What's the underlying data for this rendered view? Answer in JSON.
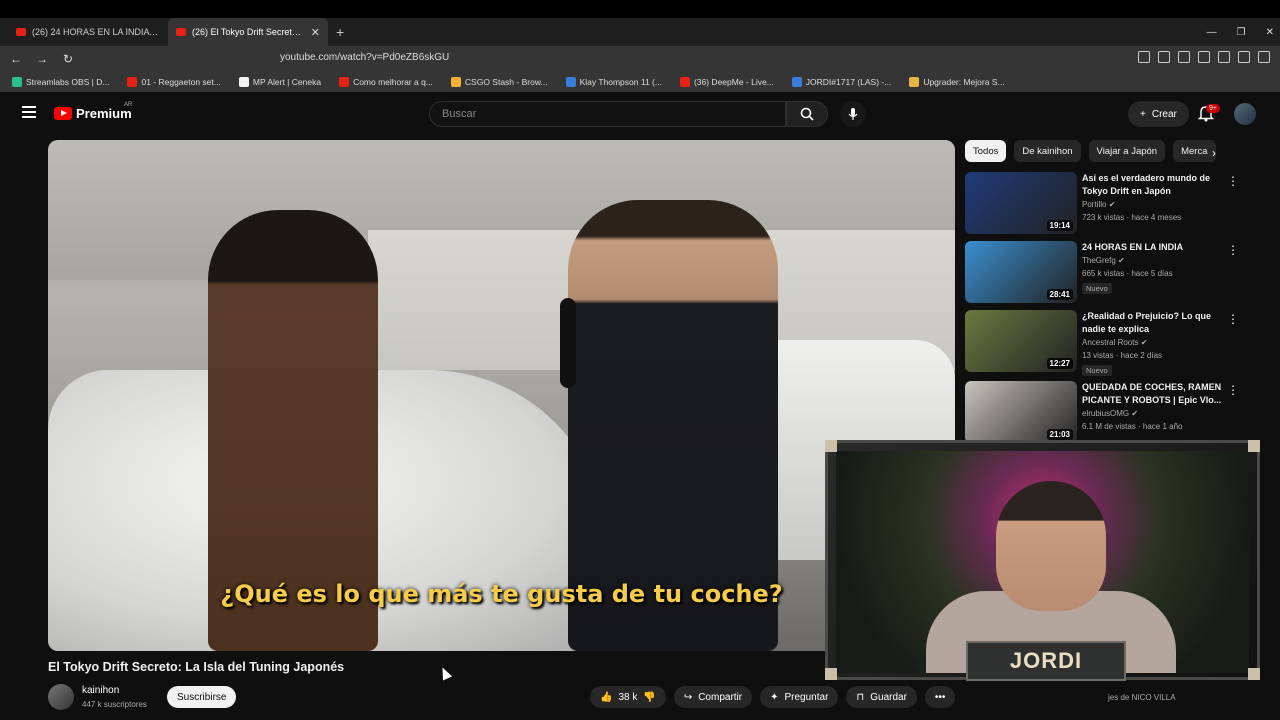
{
  "browser": {
    "tabs": [
      {
        "label": "(26) 24 HORAS EN LA INDIA - YouTube",
        "active": false
      },
      {
        "label": "(26) El Tokyo Drift Secreto: La",
        "active": true
      }
    ],
    "url": "youtube.com/watch?v=Pd0eZB6skGU",
    "bookmarks": [
      {
        "label": "Streamlabs OBS | D...",
        "color": "#2dbe8d"
      },
      {
        "label": "01 - Reggaeton set...",
        "color": "#e62117"
      },
      {
        "label": "MP Alert | Ceneka",
        "color": "#f2f2f2"
      },
      {
        "label": "Como melhorar a q...",
        "color": "#e62117"
      },
      {
        "label": "CSGO Stash - Brow...",
        "color": "#f2b233"
      },
      {
        "label": "Klay Thompson 11 (...",
        "color": "#3b7ddd"
      },
      {
        "label": "(36) DeepMe - Live...",
        "color": "#e62117"
      },
      {
        "label": "JORDI#1717 (LAS) -...",
        "color": "#3b7ddd"
      },
      {
        "label": "Upgrader: Mejora S...",
        "color": "#e7b544"
      }
    ]
  },
  "youtube": {
    "logo": "Premium",
    "country": "AR",
    "search_placeholder": "Buscar",
    "create_label": "Crear",
    "notif_badge": "9+"
  },
  "video": {
    "subtitle": "¿Qué es lo que más te gusta de tu coche?",
    "title": "El Tokyo Drift Secreto: La Isla del Tuning Japonés",
    "channel": "kainihon",
    "subscribers": "447 k suscriptores",
    "subscribe_label": "Suscribirse",
    "likes": "38 k",
    "share_label": "Compartir",
    "ask_label": "Preguntar",
    "save_label": "Guardar"
  },
  "chips": [
    "Todos",
    "De kainihon",
    "Viajar a Japón",
    "Merca"
  ],
  "recommendations": [
    {
      "title": "Así es el verdadero mundo de Tokyo Drift en Japón",
      "channel": "Portillo",
      "meta": "723 k vistas · hace 4 meses",
      "duration": "19:14",
      "new": "",
      "thumb": "#1f3b7a"
    },
    {
      "title": "24 HORAS EN LA INDIA",
      "channel": "TheGrefg",
      "meta": "665 k vistas · hace 5 días",
      "duration": "28:41",
      "new": "Nuevo",
      "thumb": "#3a8fd0"
    },
    {
      "title": "¿Realidad o Prejuicio? Lo que nadie te explica",
      "channel": "Ancestral Roots",
      "meta": "13 vistas · hace 2 días",
      "duration": "12:27",
      "new": "Nuevo",
      "thumb": "#6a7a40"
    },
    {
      "title": "QUEDADA DE COCHES, RAMEN PICANTE Y ROBOTS | Epic Vlo...",
      "channel": "elrubiusOMG",
      "meta": "6.1 M de vistas · hace 1 año",
      "duration": "21:03",
      "new": "",
      "thumb": "#c9c4be"
    }
  ],
  "webcam": {
    "name": "JORDI",
    "below_text": "jes de NICO VILLA"
  }
}
